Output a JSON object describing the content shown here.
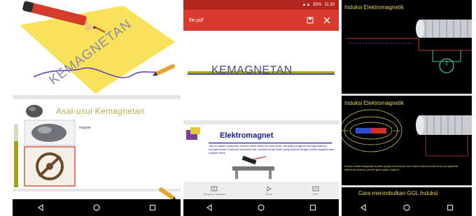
{
  "phone1": {
    "cover_title": "KEMAGNETAN",
    "slide_title": "Asal-usul Kemagnetan",
    "image_caption": "magnet"
  },
  "phone2": {
    "status_battery": "85%",
    "status_time": "11.30",
    "app_title": "file.pdf",
    "page_title": "KEMAGNETAN",
    "section_title": "Elektromagnet",
    "section_body": "Jika ke dalam kumparan berarus listrik diberi inti besi lunak, ternyata pengaruh kemagnetannya menjadi besar. Susunan kumparan dan inti besi lunak inilah yang disebut dengan elektromagnet atau magnet listrik.",
    "tabs": [
      "Tampilan halaman",
      "Putar",
      "Edit"
    ]
  },
  "phone3": {
    "panel1_title": "Induksi Elektromagnetik",
    "panel2_title": "Induksi Elektromagnetik",
    "panel2_caption": "Induksi elektromagnetik adalah gejala munculnya arus listrik induksi pada suatu penghantar akibat perubahan jumlah garis gaya magnet.",
    "panel3_title": "Cara menimbulkan GGL Induksi"
  },
  "nav_icons": [
    "back-icon",
    "home-icon",
    "recents-icon"
  ],
  "colors": {
    "accent_red": "#d93a30",
    "title_olive": "#b5b04a",
    "deep_blue": "#1a1a8c",
    "yellow_text": "#e3d25a"
  }
}
